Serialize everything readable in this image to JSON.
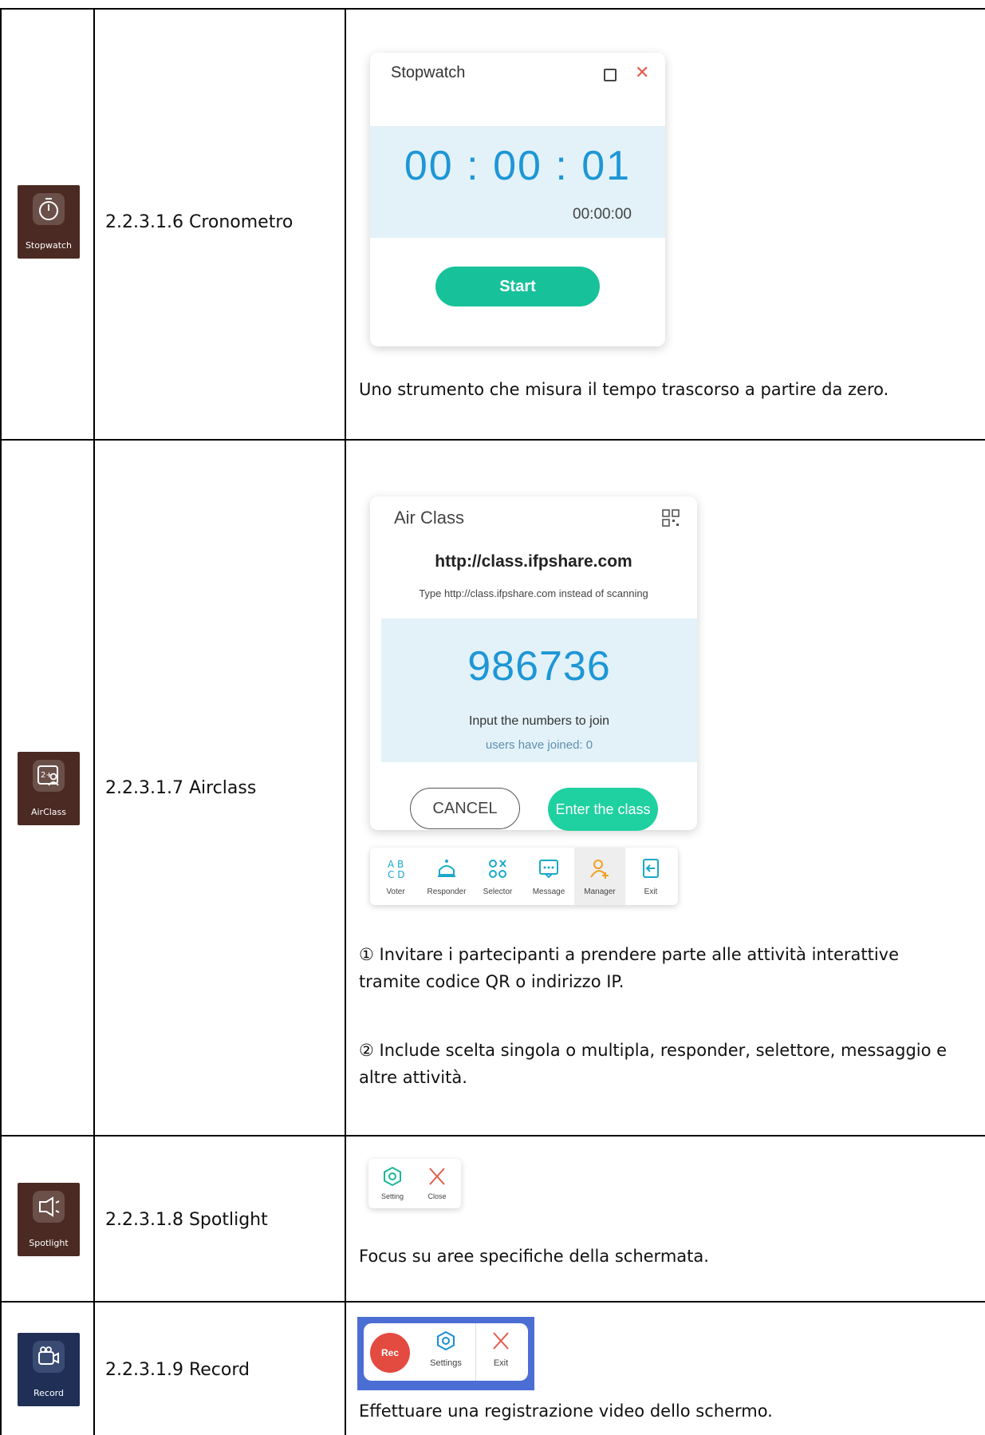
{
  "rows": [
    {
      "icon_label": "Stopwatch",
      "icon": "stopwatch-icon",
      "title": "2.2.3.1.6 Cronometro",
      "widget": {
        "title": "Stopwatch",
        "time_big": "00 : 00 : 01",
        "time_small": "00:00:00",
        "start_label": "Start"
      },
      "description": "Uno strumento che misura il tempo trascorso a partire da zero."
    },
    {
      "icon_label": "AirClass",
      "icon": "airclass-icon",
      "title": "2.2.3.1.7 Airclass",
      "widget": {
        "title": "Air Class",
        "url": "http://class.ifpshare.com",
        "hint": "Type http://class.ifpshare.com instead of scanning",
        "code": "986736",
        "join_text": "Input the numbers to join",
        "users_text": "users have joined: 0",
        "cancel_label": "CANCEL",
        "enter_label": "Enter the class",
        "toolbar": [
          {
            "label": "Voter",
            "icon": "voter-icon"
          },
          {
            "label": "Responder",
            "icon": "responder-icon"
          },
          {
            "label": "Selector",
            "icon": "selector-icon"
          },
          {
            "label": "Message",
            "icon": "message-icon"
          },
          {
            "label": "Manager",
            "icon": "manager-icon"
          },
          {
            "label": "Exit",
            "icon": "exit-icon"
          }
        ]
      },
      "description_1": "① Invitare i partecipanti a prendere parte alle attività interattive tramite codice QR o indirizzo IP.",
      "description_2": "② Include scelta singola o multipla, responder, selettore, messaggio e altre attività."
    },
    {
      "icon_label": "Spotlight",
      "icon": "spotlight-icon",
      "title": "2.2.3.1.8 Spotlight",
      "widget": {
        "setting_label": "Setting",
        "close_label": "Close"
      },
      "description": "Focus su aree specifiche della schermata."
    },
    {
      "icon_label": "Record",
      "icon": "record-icon",
      "title": "2.2.3.1.9 Record",
      "widget": {
        "rec_label": "Rec",
        "settings_label": "Settings",
        "exit_label": "Exit"
      },
      "description": "Effettuare una registrazione video dello schermo."
    }
  ],
  "colors": {
    "accent_blue": "#1e96d6",
    "accent_green": "#17c29a",
    "close_red": "#e45b4b",
    "icon_brown": "#4a2a22"
  }
}
